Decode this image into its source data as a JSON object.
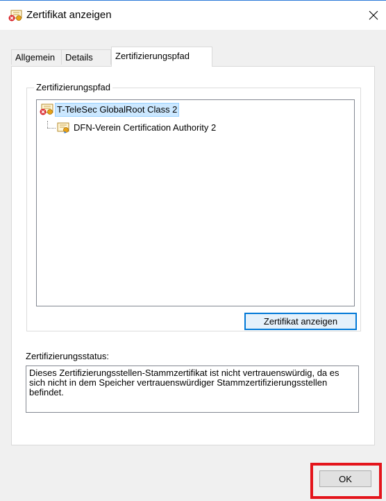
{
  "window": {
    "title": "Zertifikat anzeigen",
    "title_icon": "certificate-error-icon",
    "close_icon": "close-icon",
    "accent_color": "#2b79d8"
  },
  "tabs": [
    {
      "label": "Allgemein",
      "active": false
    },
    {
      "label": "Details",
      "active": false
    },
    {
      "label": "Zertifizierungspfad",
      "active": true
    }
  ],
  "path_group": {
    "legend": "Zertifizierungspfad",
    "tree": [
      {
        "label": "T-TeleSec GlobalRoot Class 2",
        "icon": "certificate-error-icon",
        "selected": true,
        "level": 0
      },
      {
        "label": "DFN-Verein Certification Authority 2",
        "icon": "certificate-icon",
        "selected": false,
        "level": 1
      }
    ],
    "view_button_label": "Zertifikat anzeigen"
  },
  "status": {
    "label": "Zertifizierungsstatus:",
    "text": "Dieses Zertifizierungsstellen-Stammzertifikat ist nicht vertrauenswürdig, da es sich nicht in dem Speicher vertrauenswürdiger Stammzertifizierungsstellen befindet."
  },
  "footer": {
    "ok_label": "OK",
    "highlight_color": "#e4141b"
  }
}
